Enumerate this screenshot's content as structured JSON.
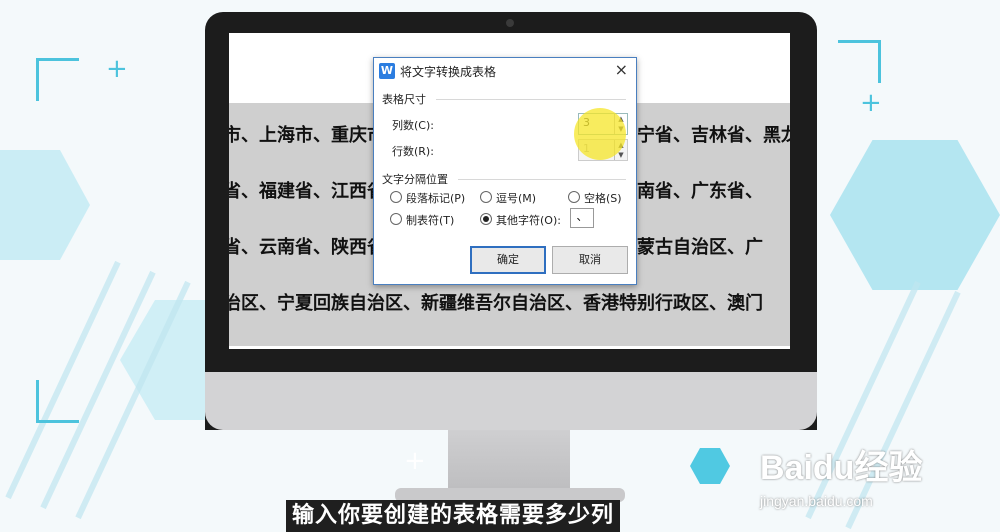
{
  "document_lines": [
    "市、上海市、重庆市、天津市、河北省、山西省、辽宁省、吉林省、黑龙江省、",
    "省、福建省、江西省、山东省、河南省、湖北省、湖南省、广东省、",
    "省、云南省、陕西省、甘肃省、青海省、台湾省、内蒙古自治区、广",
    "治区、宁夏回族自治区、新疆维吾尔自治区、香港特别行政区、澳门"
  ],
  "dialog": {
    "app_icon": "W",
    "title": "将文字转换成表格",
    "close_icon": "×",
    "size_section": "表格尺寸",
    "columns_label": "列数(C):",
    "columns_value": "3",
    "rows_label": "行数(R):",
    "rows_value": "1",
    "separator_section": "文字分隔位置",
    "options": {
      "paragraph": "段落标记(P)",
      "comma": "逗号(M)",
      "space": "空格(S)",
      "tab": "制表符(T)",
      "other": "其他字符(O):"
    },
    "selected_option": "other",
    "other_char": "、",
    "ok": "确定",
    "cancel": "取消"
  },
  "subtitle": "输入你要创建的表格需要多少列",
  "watermark": {
    "brand": "Baidu经验",
    "url": "jingyan.baidu.com"
  }
}
